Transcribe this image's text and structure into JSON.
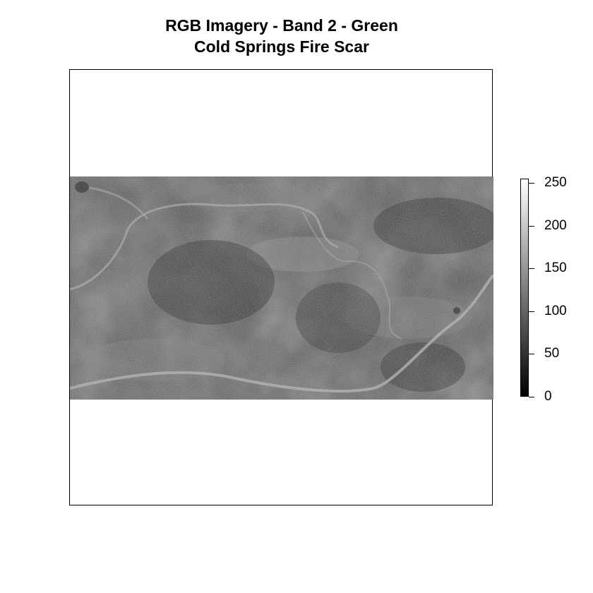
{
  "title": {
    "line1": "RGB Imagery - Band 2 - Green",
    "line2": "Cold Springs Fire Scar"
  },
  "legend": {
    "min": 0,
    "max": 255,
    "ticks": [
      {
        "value": 0,
        "label": "0"
      },
      {
        "value": 50,
        "label": "50"
      },
      {
        "value": 100,
        "label": "100"
      },
      {
        "value": 150,
        "label": "150"
      },
      {
        "value": 200,
        "label": "200"
      },
      {
        "value": 250,
        "label": "250"
      }
    ],
    "color_low": "#000000",
    "color_high": "#ffffff"
  }
}
